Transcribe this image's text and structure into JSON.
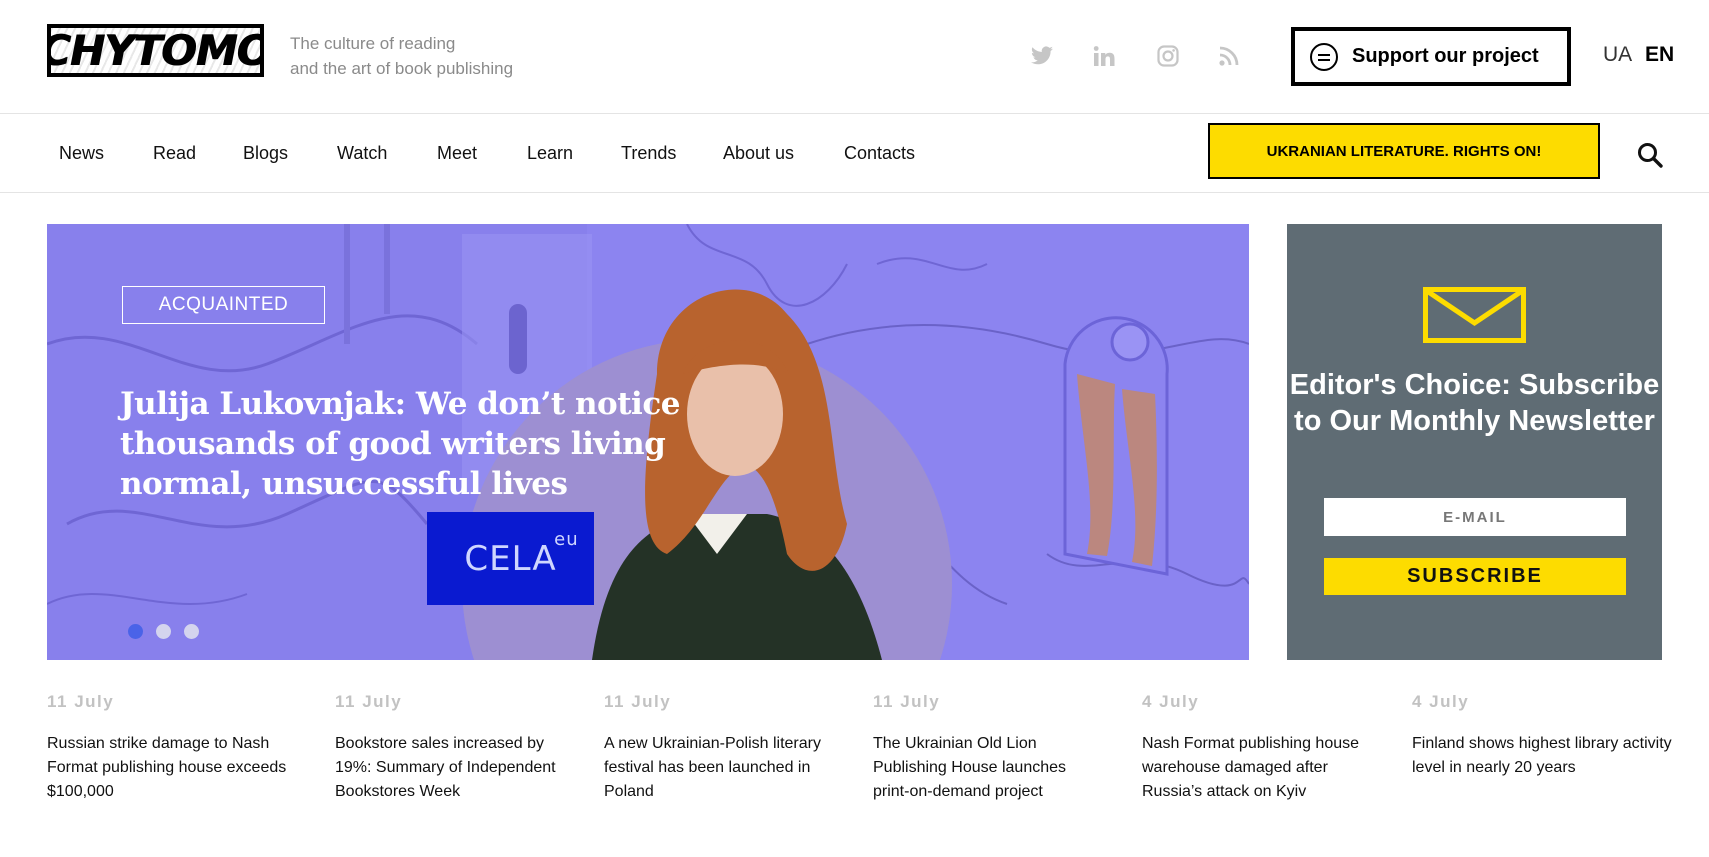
{
  "header": {
    "logo_text": "CHYTOMO",
    "tagline_line1": "The culture of reading",
    "tagline_line2": "and the art of book publishing",
    "social": [
      {
        "icon": "twitter-icon"
      },
      {
        "icon": "linkedin-icon"
      },
      {
        "icon": "instagram-icon"
      },
      {
        "icon": "rss-icon"
      }
    ],
    "support_label": "Support our project",
    "lang_ua": "UA",
    "lang_en": "EN"
  },
  "nav": {
    "items": [
      "News",
      "Read",
      "Blogs",
      "Watch",
      "Meet",
      "Learn",
      "Trends",
      "About us",
      "Contacts"
    ],
    "rights_label": "UKRANIAN LITERATURE. RIGHTS ON!"
  },
  "hero": {
    "tag": "ACQUAINTED",
    "title": "Julija Lukovnjak: We don’t notice thousands of good writers living normal, unsuccessful lives",
    "badge_text": "CELA",
    "badge_suffix": "eu",
    "slides": 3,
    "active_slide": 1
  },
  "newsletter": {
    "title": "Editor's Choice: Subscribe to Our Monthly Newsletter",
    "email_placeholder": "E-MAIL",
    "subscribe_label": "SUBSCRIBE"
  },
  "news": [
    {
      "date": "11 July",
      "title": "Russian strike damage to Nash Format publishing house exceeds $100,000"
    },
    {
      "date": "11 July",
      "title": "Bookstore sales increased by 19%: Summary of Independent Bookstores Week"
    },
    {
      "date": "11 July",
      "title": "A new Ukrainian-Polish literary festival has been launched in Poland"
    },
    {
      "date": "11 July",
      "title": "The Ukrainian Old Lion Publishing House launches print-on-demand project"
    },
    {
      "date": "4 July",
      "title": "Nash Format publishing house warehouse damaged after Russia’s attack on Kyiv"
    },
    {
      "date": "4 July",
      "title": "Finland shows highest library activity level in nearly 20 years"
    }
  ],
  "colors": {
    "accent_yellow": "#fddc00",
    "hero_purple": "#8c84f0",
    "newsletter_bg": "#5f6c74",
    "dot_active": "#4a63e8"
  }
}
